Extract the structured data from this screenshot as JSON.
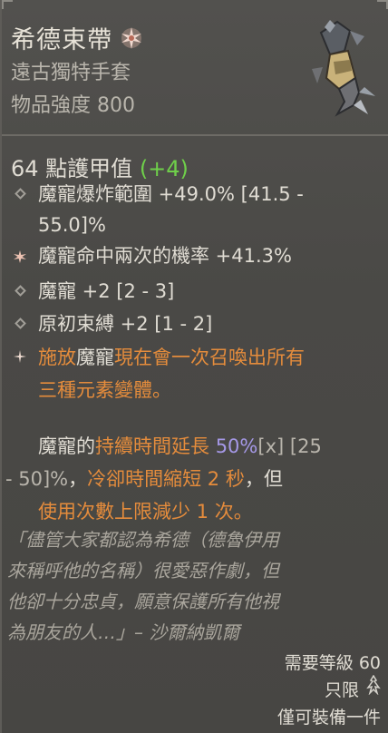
{
  "item": {
    "name": "希德束帶",
    "type": "遠古獨特手套",
    "power": "物品強度 800"
  },
  "armor": {
    "text": "64 點護甲值",
    "bonus": "(+4)"
  },
  "affixes": [
    {
      "text": "魔寵爆炸範圍 +49.0% [41.5 - 55.0]%",
      "line1": "魔寵爆炸範圍 +49.0% [41.5 -",
      "line2": "55.0]%"
    },
    {
      "text": "魔寵命中兩次的機率 +41.3%"
    },
    {
      "text": "魔寵 +2 [2 - 3]"
    },
    {
      "text": "原初束縛 +2 [1 - 2]"
    }
  ],
  "legendary": {
    "p1_a": "施放",
    "p1_b": "魔寵",
    "p1_c": "現在會一次召喚出所有",
    "p1_d": "三種元素變體。",
    "p2_a": "魔寵",
    "p2_b": "的",
    "p2_c": "持續時間延長",
    "p2_d": "50%",
    "p2_e": "[x]",
    "p2_f": "[25",
    "p2_g": "- 50]%",
    "p2_h": "，",
    "p2_i": "冷卻時間縮短 2 秒",
    "p2_j": "，但",
    "p2_k": "使用次數上限減少 1 次。"
  },
  "flavor": {
    "line1": "「儘管大家都認為希德（德魯伊用",
    "line2": "來稱呼他的名稱）很愛惡作劇，但",
    "line3": "他卻十分忠貞，願意保護所有他視",
    "line4": "為朋友的人…」– 沙爾納凱爾"
  },
  "requirements": {
    "level": "需要等級 60",
    "class": "只限",
    "unique": "僅可裝備一件"
  },
  "colors": {
    "legendary": "#e58c3c",
    "bonus_green": "#6fcf4a",
    "purple": "#a598e6"
  }
}
